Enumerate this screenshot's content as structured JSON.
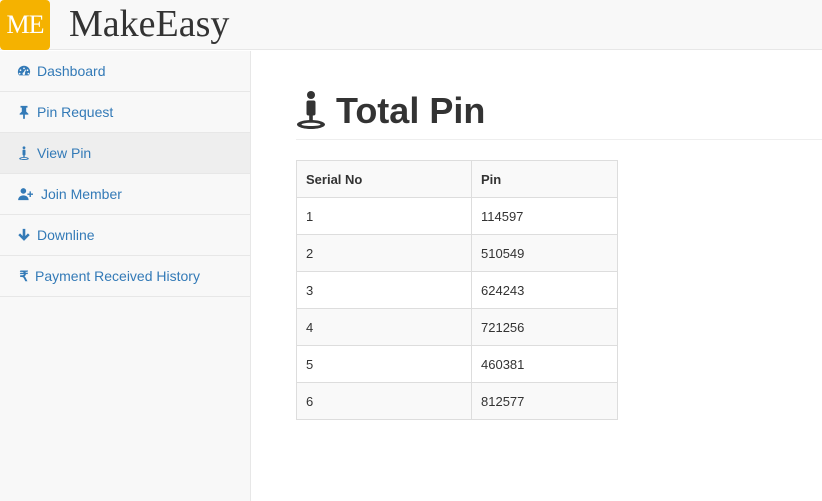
{
  "brand": {
    "logo_text": "ME",
    "name": "MakeEasy",
    "logo_color": "#f5b200"
  },
  "sidebar": {
    "items": [
      {
        "label": "Dashboard",
        "icon": "dashboard-icon"
      },
      {
        "label": "Pin Request",
        "icon": "pushpin-icon"
      },
      {
        "label": "View Pin",
        "icon": "map-marker-person-icon",
        "active": true
      },
      {
        "label": "Join Member",
        "icon": "add-user-icon"
      },
      {
        "label": "Downline",
        "icon": "arrow-down-icon"
      },
      {
        "label": "Payment Received History",
        "icon": "rupee-icon",
        "glyph": "₹"
      }
    ]
  },
  "main": {
    "title": "Total Pin",
    "title_icon": "map-marker-person-icon",
    "table": {
      "headers": [
        "Serial No",
        "Pin"
      ],
      "rows": [
        {
          "serial": "1",
          "pin": "114597"
        },
        {
          "serial": "2",
          "pin": "510549"
        },
        {
          "serial": "3",
          "pin": "624243"
        },
        {
          "serial": "4",
          "pin": "721256"
        },
        {
          "serial": "5",
          "pin": "460381"
        },
        {
          "serial": "6",
          "pin": "812577"
        }
      ]
    }
  },
  "colors": {
    "link": "#337ab7",
    "sidebar_bg": "#f8f8f8",
    "active_item_bg": "#eeeeee"
  }
}
